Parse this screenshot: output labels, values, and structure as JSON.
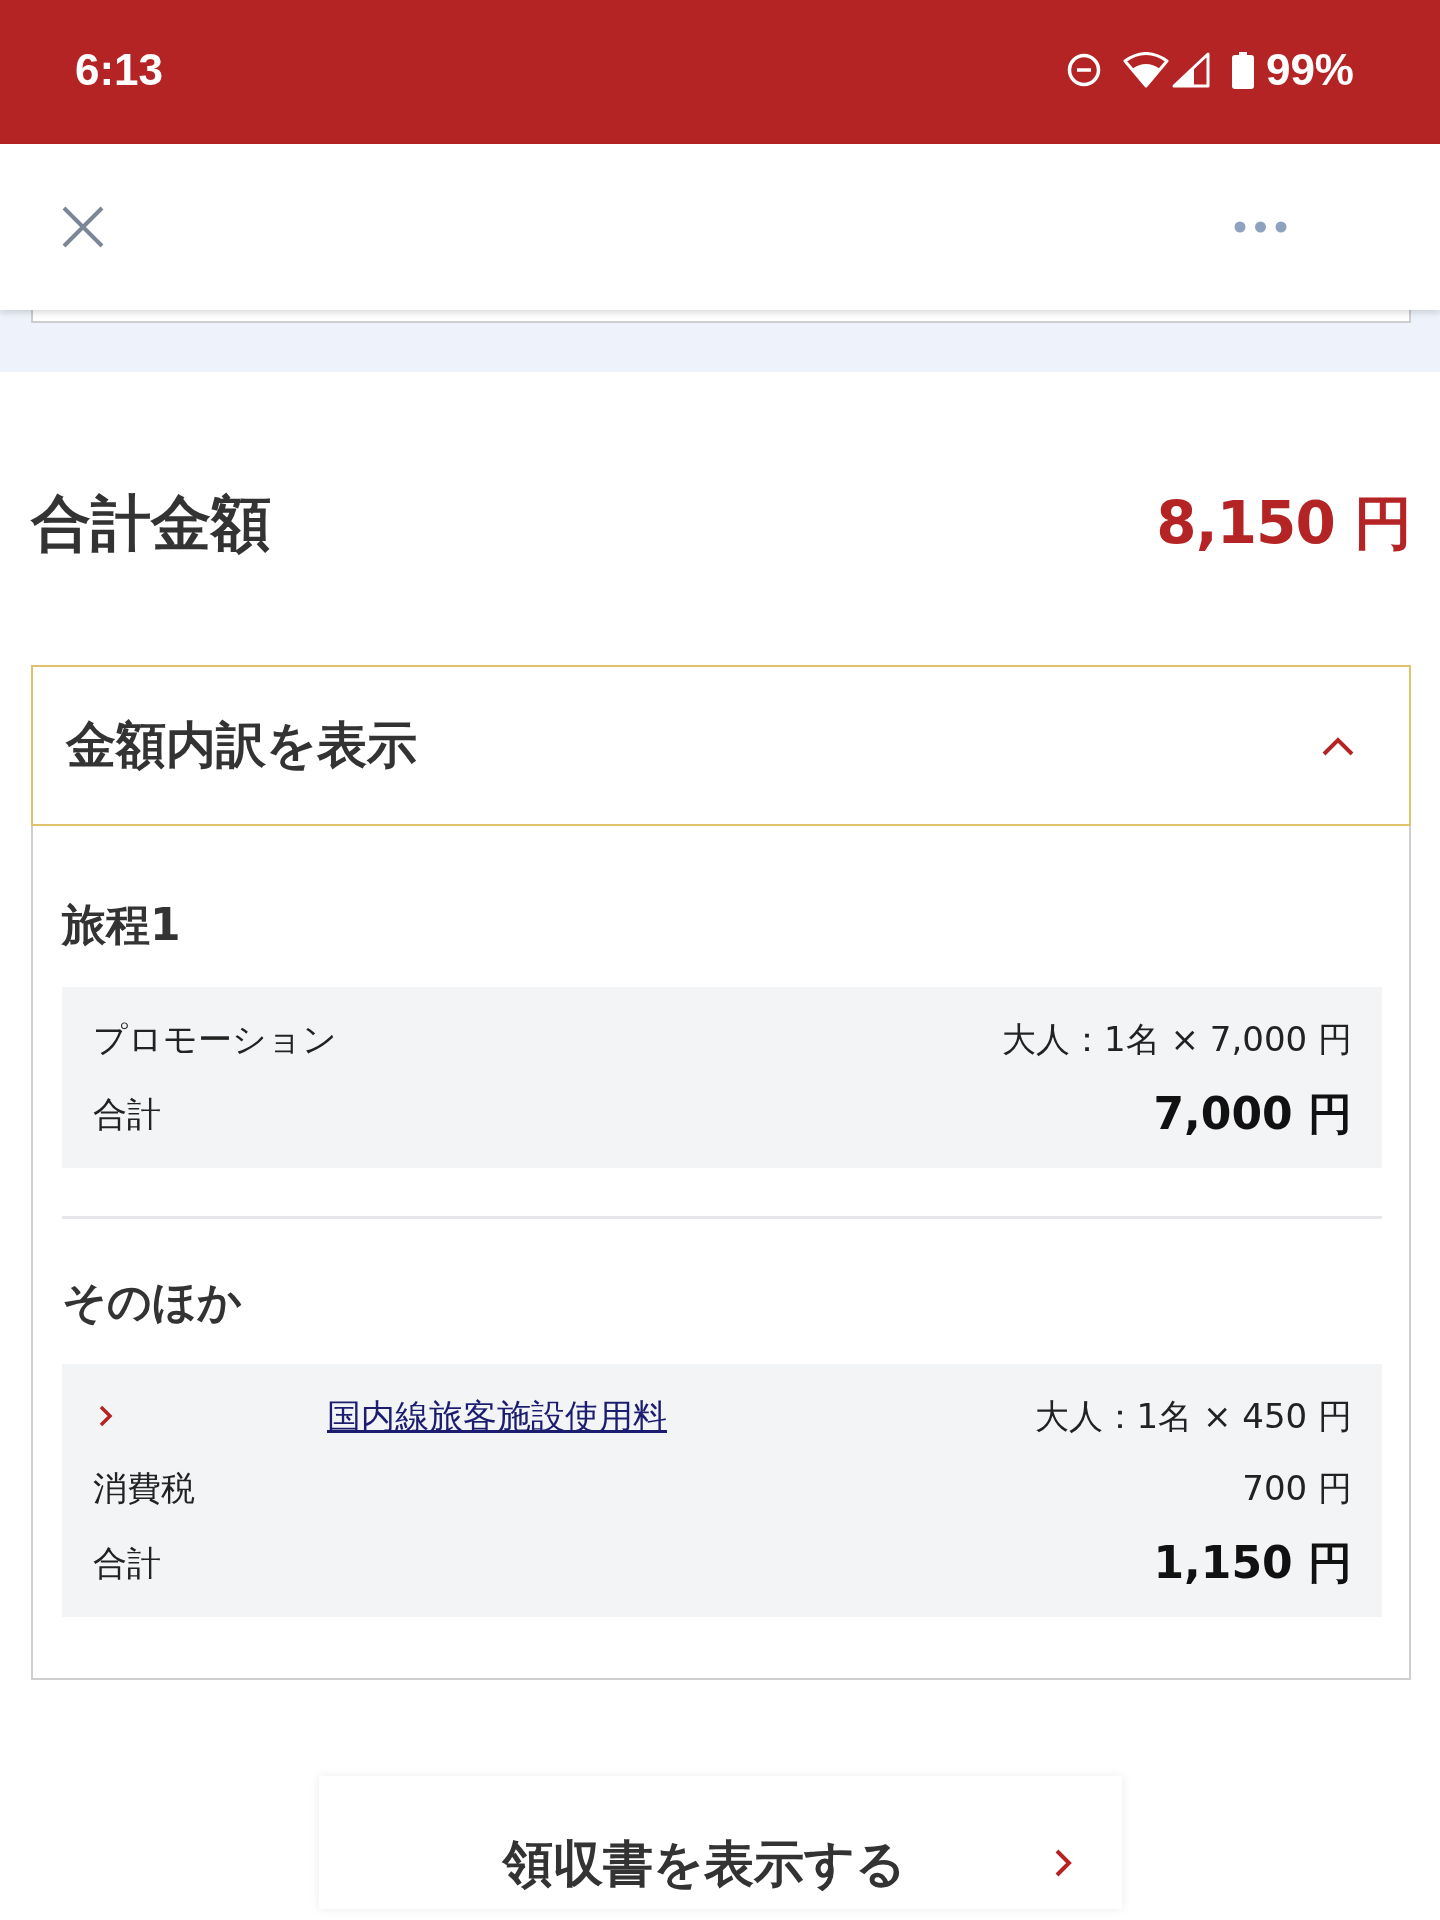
{
  "status_bar": {
    "time": "6:13",
    "battery": "99%"
  },
  "total": {
    "label": "合計金額",
    "amount": "8,150 円"
  },
  "breakdown": {
    "title": "金額内訳を表示",
    "expanded": true,
    "sections": [
      {
        "title": "旅程1",
        "rows": [
          {
            "kind": "item",
            "label": "プロモーション",
            "value": "大人：1名 × 7,000 円"
          },
          {
            "kind": "total",
            "label": "合計",
            "value": "7,000 円"
          }
        ]
      },
      {
        "title": "そのほか",
        "rows": [
          {
            "kind": "link",
            "label": "国内線旅客施設使用料",
            "value": "大人：1名 × 450 円"
          },
          {
            "kind": "item",
            "label": "消費税",
            "value": "700 円"
          },
          {
            "kind": "total",
            "label": "合計",
            "value": "1,150 円"
          }
        ]
      }
    ]
  },
  "receipt_button": {
    "label": "領収書を表示する"
  }
}
